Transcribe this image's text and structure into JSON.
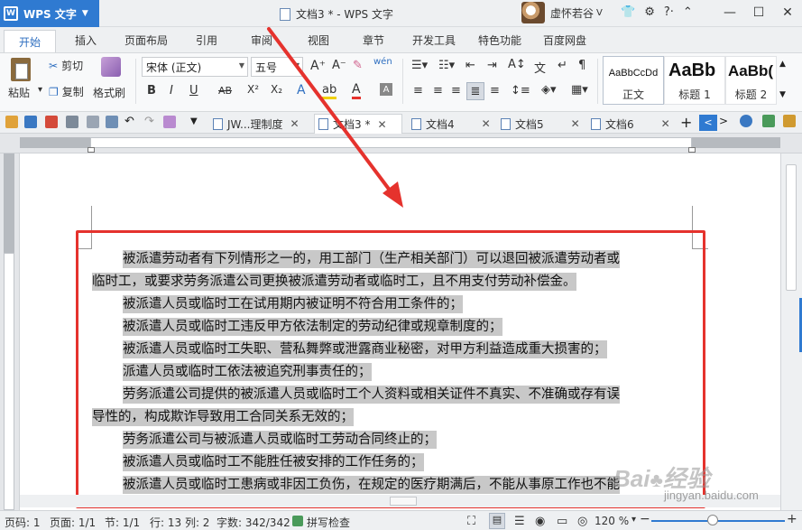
{
  "app": {
    "name": "WPS 文字",
    "document_title": "文档3 * - WPS 文字",
    "user_name": "虚怀若谷"
  },
  "menu": {
    "tabs": [
      "开始",
      "插入",
      "页面布局",
      "引用",
      "审阅",
      "视图",
      "章节",
      "开发工具",
      "特色功能",
      "百度网盘"
    ]
  },
  "ribbon": {
    "paste": "粘贴",
    "cut": "剪切",
    "copy": "复制",
    "format_painter": "格式刷",
    "font_name": "宋体 (正文)",
    "font_size": "五号",
    "styles": [
      {
        "sample": "AaBbCcDd",
        "name": "正文"
      },
      {
        "sample": "AaBb",
        "name": "标题 1"
      },
      {
        "sample": "AaBb(",
        "name": "标题 2"
      }
    ]
  },
  "doc_tabs": [
    {
      "label": "JW...理制度"
    },
    {
      "label": "文档3 *"
    },
    {
      "label": "文档4"
    },
    {
      "label": "文档5"
    },
    {
      "label": "文档6"
    }
  ],
  "document": {
    "paragraphs": [
      {
        "first": "被派遣劳动者有下列情形之一的，用工部门（生产相关部门）可以退回被派遣劳动者或",
        "rest": "临时工，或要求劳务派遣公司更换被派遣劳动者或临时工，且不用支付劳动补偿金。"
      },
      {
        "first": "被派遣人员或临时工在试用期内被证明不符合用工条件的；"
      },
      {
        "first": "被派遣人员或临时工违反甲方依法制定的劳动纪律或规章制度的；"
      },
      {
        "first": "被派遣人员或临时工失职、营私舞弊或泄露商业秘密，对甲方利益造成重大损害的；"
      },
      {
        "first": "派遣人员或临时工依法被追究刑事责任的；"
      },
      {
        "first": "劳务派遣公司提供的被派遣人员或临时工个人资料或相关证件不真实、不准确或存有误",
        "rest": "导性的，构成欺诈导致用工合同关系无效的；"
      },
      {
        "first": "劳务派遣公司与被派遣人员或临时工劳动合同终止的；"
      },
      {
        "first": "被派遣人员或临时工不能胜任被安排的工作任务的；"
      },
      {
        "first": "被派遣人员或临时工患病或非因工负伤，在规定的医疗期满后，不能从事原工作也不能"
      }
    ]
  },
  "statusbar": {
    "page_code": "页码: 1",
    "pages": "页面: 1/1",
    "section": "节: 1/1",
    "row_col": "行: 13  列: 2",
    "word_count": "字数: 342/342",
    "spell_check": "拼写检查",
    "zoom": "120 %"
  },
  "watermark": "jingyan.baidu.com",
  "colors": {
    "accent": "#2f7ad1",
    "annotation": "#e5322d",
    "selection": "#c8c8c8"
  }
}
